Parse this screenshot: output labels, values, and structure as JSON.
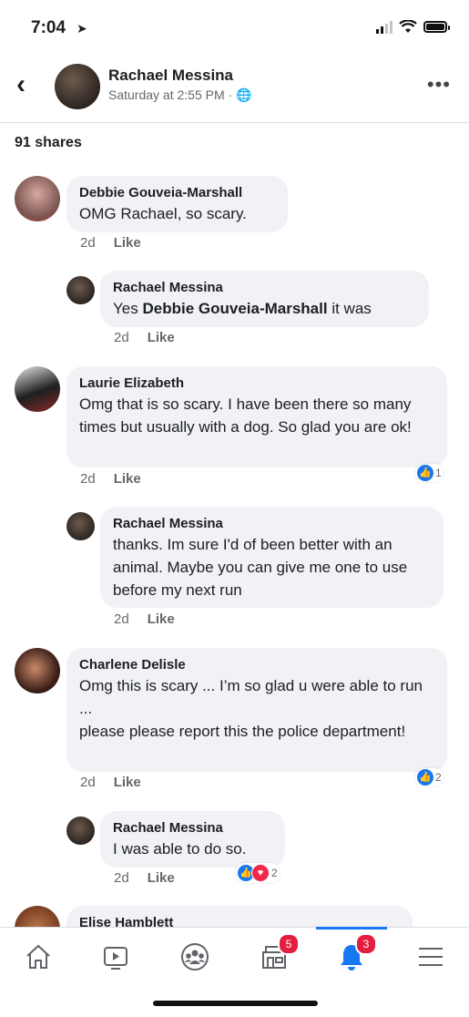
{
  "status_bar": {
    "time": "7:04"
  },
  "header": {
    "name": "Rachael Messina",
    "time": "Saturday at 2:55 PM · 🌐"
  },
  "shares": "91 shares",
  "comments": [
    {
      "name": "Debbie Gouveia-Marshall",
      "text": "OMG Rachael, so scary.",
      "age": "2d",
      "like": "Like"
    },
    {
      "name": "Rachael Messina",
      "text_prefix": "Yes ",
      "text_bold": "Debbie Gouveia-Marshall",
      "text_suffix": " it was",
      "age": "2d",
      "like": "Like"
    },
    {
      "name": "Laurie Elizabeth",
      "text": "Omg that is so scary.  I have been there so many times but usually with a dog.  So glad you are ok!",
      "age": "2d",
      "like": "Like",
      "reactions": "1"
    },
    {
      "name": "Rachael Messina",
      "text": "thanks. Im sure I'd of been better with an animal. Maybe you can give me one to use before my next run",
      "age": "2d",
      "like": "Like"
    },
    {
      "name": "Charlene Delisle",
      "text": "Omg this is scary ... I’m so glad u were able to run ...\nplease please report this the police department!",
      "age": "2d",
      "like": "Like",
      "reactions": "2"
    },
    {
      "name": "Rachael Messina",
      "text": "I was able to do so.",
      "age": "2d",
      "like": "Like",
      "reactions": "2"
    },
    {
      "name": "Elise Hamblett"
    }
  ],
  "tabbar": {
    "marketplace_badge": "5",
    "notifications_badge": "3"
  }
}
